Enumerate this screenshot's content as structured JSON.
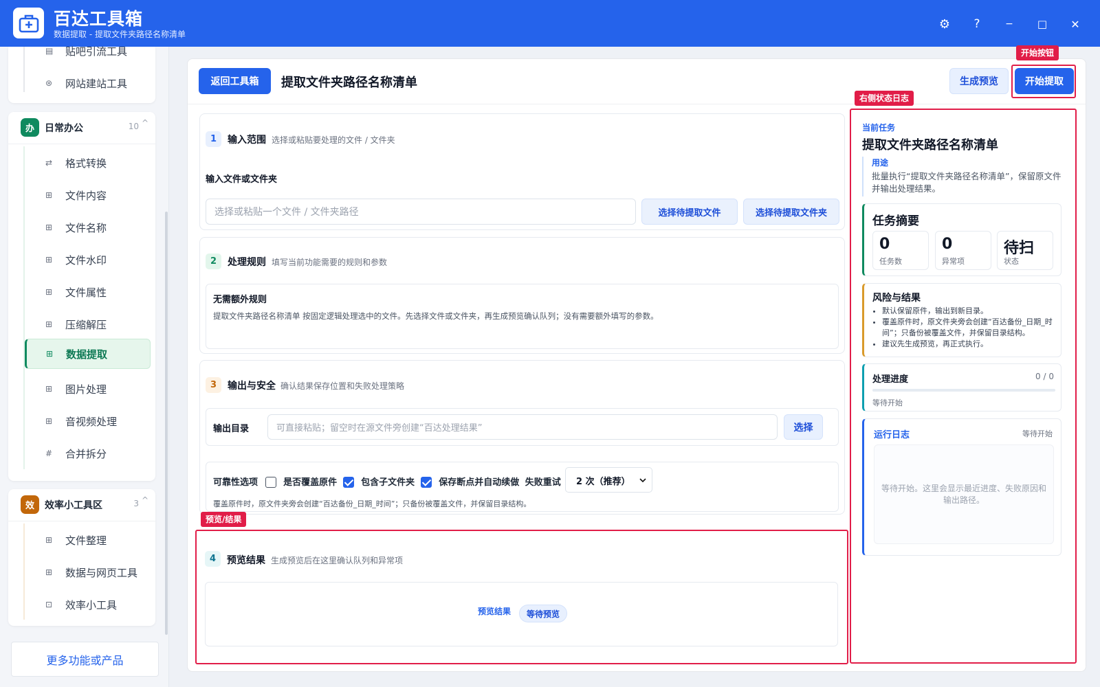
{
  "app": {
    "title": "百达工具箱",
    "subtitle": "数据提取 - 提取文件夹路径名称清单",
    "settings_icon": "⚙",
    "help_icon": "?",
    "min_icon": "−",
    "max_icon": "□",
    "close_icon": "✕"
  },
  "sidebar": {
    "top_items": [
      {
        "label": "贴吧引流工具",
        "icon": "▤"
      },
      {
        "label": "网站建站工具",
        "icon": "⊛"
      }
    ],
    "groups": [
      {
        "badge": "办",
        "badge_color": "#0f8a5f",
        "title": "日常办公",
        "count": "10",
        "chevron": "^",
        "items": [
          {
            "label": "格式转换",
            "icon": "⇄"
          },
          {
            "label": "文件内容",
            "icon": "⊞"
          },
          {
            "label": "文件名称",
            "icon": "⊞"
          },
          {
            "label": "文件水印",
            "icon": "⊞"
          },
          {
            "label": "文件属性",
            "icon": "⊞"
          },
          {
            "label": "压缩解压",
            "icon": "⊞"
          },
          {
            "label": "数据提取",
            "icon": "⊞"
          },
          {
            "label": "图片处理",
            "icon": "⊞"
          },
          {
            "label": "音视频处理",
            "icon": "⊞"
          },
          {
            "label": "合并拆分",
            "icon": "#"
          }
        ]
      },
      {
        "badge": "效",
        "badge_color": "#c2670a",
        "title": "效率小工具区",
        "count": "3",
        "chevron": "^",
        "items": [
          {
            "label": "文件整理",
            "icon": "⊞"
          },
          {
            "label": "数据与网页工具",
            "icon": "⊞"
          },
          {
            "label": "效率小工具",
            "icon": "⊡"
          }
        ]
      }
    ],
    "more_label": "更多功能或产品"
  },
  "toolbar": {
    "back_label": "返回工具箱",
    "page_title": "提取文件夹路径名称清单",
    "preview_label": "生成预览",
    "start_label": "开始提取"
  },
  "annotations": {
    "start_tag": "开始按钮",
    "log_tag": "右侧状态日志",
    "preview_tag": "预览/结果"
  },
  "section1": {
    "num": "1",
    "title": "输入范围",
    "desc": "选择或粘贴要处理的文件 / 文件夹",
    "field_label": "输入文件或文件夹",
    "placeholder": "选择或粘贴一个文件 / 文件夹路径",
    "pick_file": "选择待提取文件",
    "pick_folder": "选择待提取文件夹"
  },
  "section2": {
    "num": "2",
    "title": "处理规则",
    "desc": "填写当前功能需要的规则和参数",
    "rule_title": "无需额外规则",
    "rule_text": "提取文件夹路径名称清单 按固定逻辑处理选中的文件。先选择文件或文件夹，再生成预览确认队列；没有需要额外填写的参数。"
  },
  "section3": {
    "num": "3",
    "title": "输出与安全",
    "desc": "确认结果保存位置和失败处理策略",
    "output_label": "输出目录",
    "output_placeholder": "可直接粘贴；留空时在源文件旁创建“百达处理结果”",
    "choose": "选择",
    "reliability_label": "可靠性选项",
    "overwrite": "是否覆盖原件",
    "subfolders": "包含子文件夹",
    "resume": "保存断点并自动续做",
    "retry_label": "失败重试",
    "retry_value": "2 次（推荐）",
    "note": "覆盖原件时，原文件夹旁会创建“百达备份_日期_时间”；只备份被覆盖文件，并保留目录结构。"
  },
  "section4": {
    "num": "4",
    "title": "预览结果",
    "desc": "生成预览后在这里确认队列和异常项",
    "result_label": "预览结果",
    "status": "等待预览"
  },
  "right": {
    "current_task_label": "当前任务",
    "task_title": "提取文件夹路径名称清单",
    "purpose_label": "用途",
    "purpose_text": "批量执行“提取文件夹路径名称清单”，保留原文件并输出处理结果。",
    "summary_title": "任务摘要",
    "stats": [
      {
        "value": "0",
        "key": "任务数"
      },
      {
        "value": "0",
        "key": "异常项"
      },
      {
        "value": "待扫",
        "key": "状态"
      }
    ],
    "risk_title": "风险与结果",
    "risk_items": [
      "默认保留原件，输出到新目录。",
      "覆盖原件时，原文件夹旁会创建“百达备份_日期_时间”；只备份被覆盖文件，并保留目录结构。",
      "建议先生成预览，再正式执行。"
    ],
    "progress_title": "处理进度",
    "progress_count": "0 / 0",
    "progress_fraction": 0,
    "progress_status": "等待开始",
    "log_title": "运行日志",
    "log_status": "等待开始",
    "log_placeholder": "等待开始。这里会显示最近进度、失败原因和输出路径。"
  }
}
